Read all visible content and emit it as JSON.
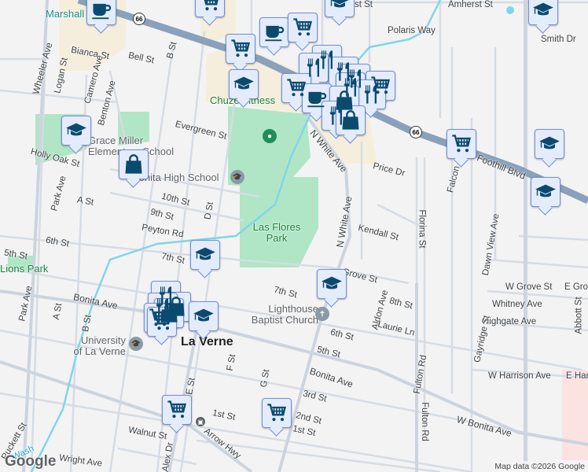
{
  "colors": {
    "marker_fill": "#e4ecfb",
    "marker_border": "#6f90d6",
    "icon": "#0b4a6f",
    "highway": "#8aa1bb",
    "park": "#a8e4c0",
    "commercial": "#f5eedc",
    "water": "#7fd6ea"
  },
  "labels": {
    "marshall": "Marshall",
    "amherst": "Amherst St",
    "amherst_partial": "st St",
    "polaris": "Polaris Way",
    "smith": "Smith Dr",
    "bianca": "Bianca St",
    "bell": "Bell St",
    "b_st": "B St",
    "wheeler": "Wheeler Ave",
    "logan": "Logan St",
    "camero": "Camero Ave",
    "benton": "Benton Ave",
    "chuze": "Chuze Fitness",
    "evergreen": "Evergreen St",
    "grace_miller": "Grace Miller Elementary School",
    "holly_oak": "Holly Oak St",
    "bonita_hs": "Bonita High School",
    "park_ave": "Park Ave",
    "a_st": "A St",
    "tenth": "10th St",
    "ninth": "9th St",
    "d_st": "D St",
    "peyton": "Peyton Rd",
    "las_flores": "Las Flores Park",
    "n_white": "N White Ave",
    "n_white2": "N White Ave",
    "price": "Price Dr",
    "falcon": "Falcon",
    "foothill": "Foothill Blvd",
    "florin": "Florina St",
    "kendall": "Kendall St",
    "fifth": "5th St",
    "sixth": "6th St",
    "seventh": "7th St",
    "lions_park": "Lions Park",
    "bonita": "Bonita Ave",
    "b_st2": "B St",
    "park_ave2": "Park Ave",
    "a_st2": "A St",
    "u_lv": "University of La Verne",
    "la_verne": "La Verne",
    "e_st": "E St",
    "f_st": "F St",
    "g_st": "G St",
    "lighthouse": "Lighthouse Baptist Church",
    "grove": "Grove St",
    "eighth": "8th St",
    "aldon": "Aldon Ave",
    "laurie": "Laurie Ln",
    "sixth2": "6th St",
    "fifth2": "5th St",
    "bonita2": "Bonita Ave",
    "third": "3rd St",
    "second": "2nd St",
    "first": "1st St",
    "first2": "1st St",
    "walnut": "Walnut St",
    "arrow": "Arrow Hwy",
    "wright": "Wright Ave",
    "pickett": "Puckett St",
    "wash": "Wash",
    "fulton": "Fulton Rd",
    "fulton2": "Fulton Rd",
    "dawn": "Dawn View Ave",
    "w_grove": "W Grove St",
    "e_grove": "E Grove",
    "whitney": "Whitney Ave",
    "highgate": "Highgate Ave",
    "gayridge": "Gayridge St",
    "abbott": "Abbott St",
    "w_harrison": "W Harrison Ave",
    "e_harrison": "E Har",
    "w_bonita": "W Bonita Ave",
    "seventh2": "7th St",
    "sixth3": "6th St",
    "d_dr": "D",
    "alex": "Alex Dr",
    "seventh3": "7th St"
  },
  "shield": "66",
  "attribution": "Map data ©2026 Google",
  "logo": "Google"
}
